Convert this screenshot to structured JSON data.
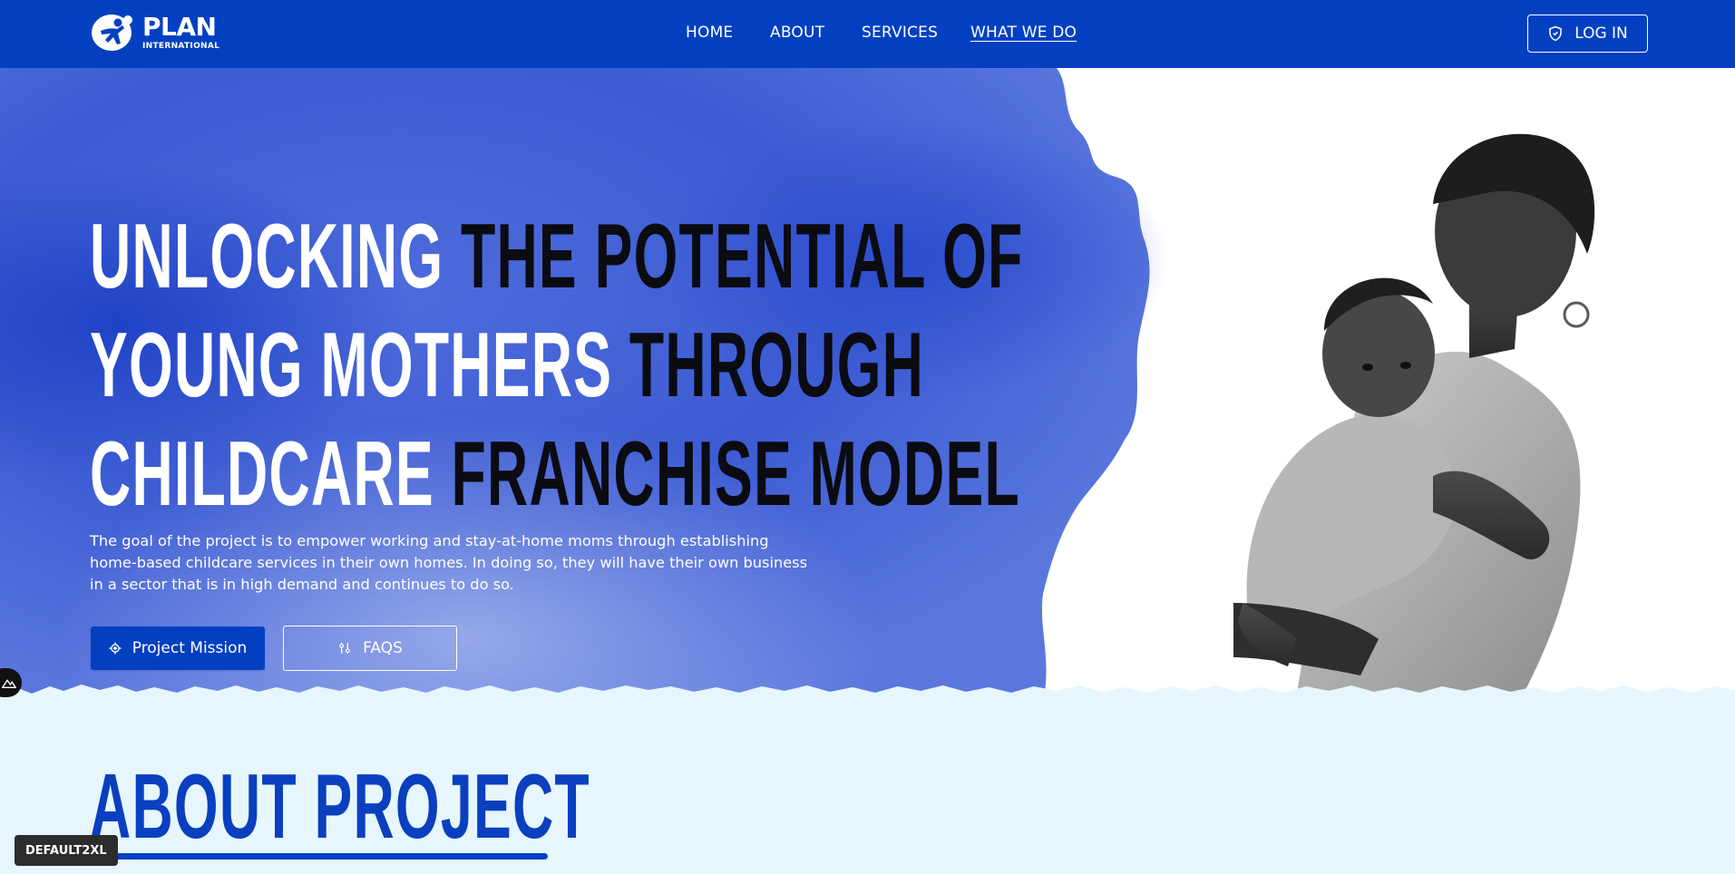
{
  "brand": {
    "name": "PLAN",
    "subtitle": "INTERNATIONAL"
  },
  "nav": {
    "items": [
      {
        "label": "HOME",
        "active": false
      },
      {
        "label": "ABOUT",
        "active": false
      },
      {
        "label": "SERVICES",
        "active": false
      },
      {
        "label": "WHAT WE DO",
        "active": true
      }
    ],
    "login_label": "LOG IN"
  },
  "hero": {
    "line1_light": "UNLOCKING ",
    "line1_dark": "THE POTENTIAL OF",
    "line2_light": "YOUNG MOTHERS ",
    "line2_dark": "THROUGH",
    "line3_light": "CHILDCARE ",
    "line3_dark": "FRANCHISE MODEL",
    "description": "The goal of the project is to empower working and stay-at-home moms through establishing home-based childcare services in their own homes. In doing so, they will have their own business in a sector that is in high demand and continues to do so.",
    "primary_button": "Project Mission",
    "secondary_button": "FAQS"
  },
  "about": {
    "title": "ABOUT PROJECT"
  },
  "debug_badge": "DEFAULT2XL",
  "colors": {
    "brand_blue": "#0340c1",
    "watercolor_blue": "#3f5fd6",
    "about_bg": "#e6f6fc"
  },
  "icons": {
    "login": "shield-icon",
    "project_mission": "target-icon",
    "faqs": "sliders-icon",
    "side_tab": "mountain-icon"
  }
}
